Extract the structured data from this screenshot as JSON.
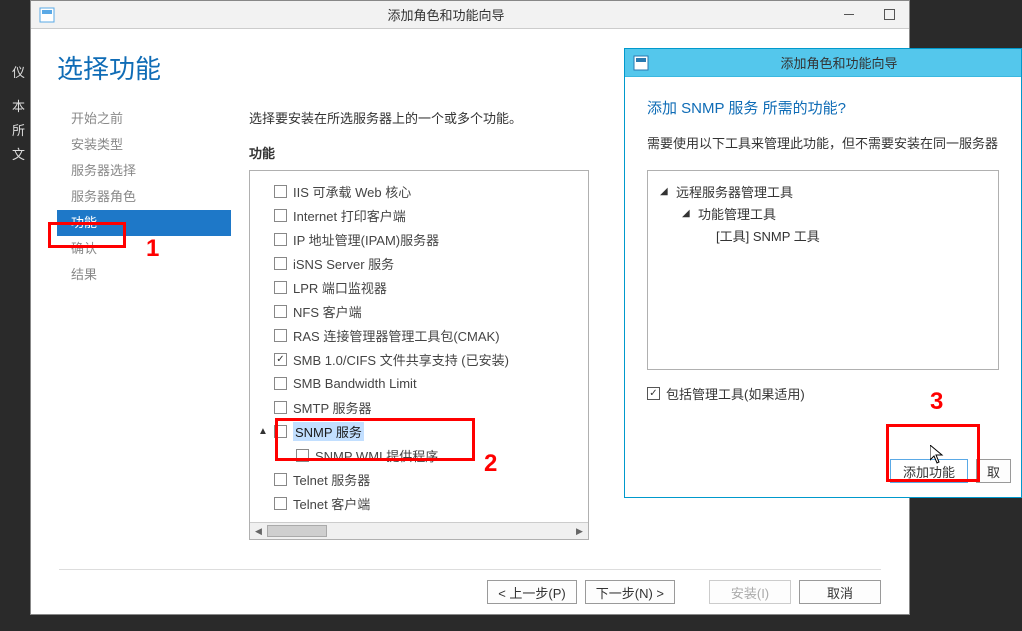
{
  "main_window": {
    "title": "添加角色和功能向导",
    "page_title": "选择功能",
    "instruction": "选择要安装在所选服务器上的一个或多个功能。",
    "features_label": "功能",
    "sidebar": [
      {
        "label": "开始之前",
        "selected": false
      },
      {
        "label": "安装类型",
        "selected": false
      },
      {
        "label": "服务器选择",
        "selected": false
      },
      {
        "label": "服务器角色",
        "selected": false
      },
      {
        "label": "功能",
        "selected": true
      },
      {
        "label": "确认",
        "selected": false
      },
      {
        "label": "结果",
        "selected": false
      }
    ],
    "features": [
      {
        "label": "IIS 可承载 Web 核心",
        "checked": false,
        "indent": false
      },
      {
        "label": "Internet 打印客户端",
        "checked": false,
        "indent": false
      },
      {
        "label": "IP 地址管理(IPAM)服务器",
        "checked": false,
        "indent": false
      },
      {
        "label": "iSNS Server 服务",
        "checked": false,
        "indent": false
      },
      {
        "label": "LPR 端口监视器",
        "checked": false,
        "indent": false
      },
      {
        "label": "NFS 客户端",
        "checked": false,
        "indent": false
      },
      {
        "label": "RAS 连接管理器管理工具包(CMAK)",
        "checked": false,
        "indent": false
      },
      {
        "label": "SMB 1.0/CIFS 文件共享支持 (已安装)",
        "checked": true,
        "indent": false
      },
      {
        "label": "SMB Bandwidth Limit",
        "checked": false,
        "indent": false
      },
      {
        "label": "SMTP 服务器",
        "checked": false,
        "indent": false
      },
      {
        "label": "SNMP 服务",
        "checked": false,
        "indent": false,
        "expander": "▲",
        "highlighted": true
      },
      {
        "label": "SNMP WMI 提供程序",
        "checked": false,
        "indent": true
      },
      {
        "label": "Telnet 服务器",
        "checked": false,
        "indent": false
      },
      {
        "label": "Telnet 客户端",
        "checked": false,
        "indent": false
      }
    ],
    "buttons": {
      "prev": "< 上一步(P)",
      "next": "下一步(N) >",
      "install": "安装(I)",
      "cancel": "取消"
    }
  },
  "sub_dialog": {
    "title": "添加角色和功能向导",
    "question": "添加 SNMP 服务 所需的功能?",
    "description": "需要使用以下工具来管理此功能，但不需要安装在同一服务器",
    "tree": [
      {
        "label": "远程服务器管理工具",
        "level": 1,
        "tri": "◢"
      },
      {
        "label": "功能管理工具",
        "level": 2,
        "tri": "◢"
      },
      {
        "label": "[工具] SNMP 工具",
        "level": 3,
        "tri": ""
      }
    ],
    "include_label": "包括管理工具(如果适用)",
    "include_checked": true,
    "buttons": {
      "add": "添加功能",
      "cancel": "取"
    }
  },
  "annotations": {
    "a1": "1",
    "a2": "2",
    "a3": "3"
  },
  "bg_fragments": [
    "仪",
    "本",
    "所",
    "文"
  ]
}
